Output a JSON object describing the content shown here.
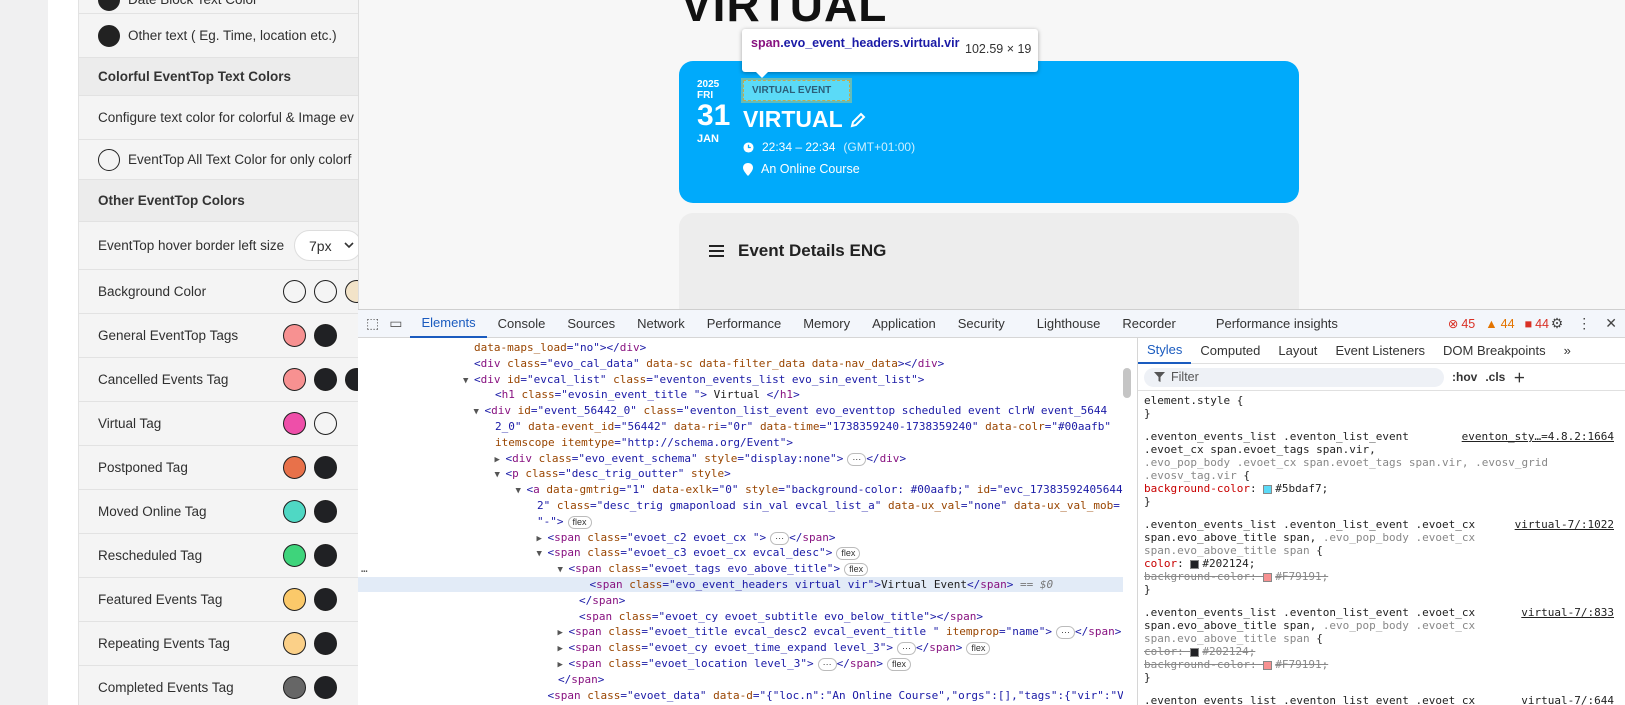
{
  "settings": {
    "rows": [
      {
        "type": "radio",
        "label": "Date Block Text Color",
        "filled": true
      },
      {
        "type": "radio",
        "label": "Other text ( Eg. Time, location etc.)",
        "filled": true
      },
      {
        "type": "head",
        "label": "Colorful EventTop Text Colors"
      },
      {
        "type": "text",
        "label": "Configure text color for colorful & Image ev"
      },
      {
        "type": "radio",
        "label": "EventTop All Text Color for only colorf",
        "filled": false
      },
      {
        "type": "head",
        "label": "Other EventTop Colors"
      },
      {
        "type": "select",
        "label": "EventTop hover border left size",
        "value": "7px"
      },
      {
        "type": "swatch",
        "label": "Background Color",
        "colors": [
          "#f4f4f4",
          "#f4f4f4",
          "#f2e3c8"
        ]
      },
      {
        "type": "swatch",
        "label": "General EventTop Tags",
        "colors": [
          "#f79191",
          "#202124"
        ]
      },
      {
        "type": "swatch",
        "label": "Cancelled Events Tag",
        "colors": [
          "#f79191",
          "#202124",
          "#202124"
        ]
      },
      {
        "type": "swatch",
        "label": "Virtual Tag",
        "colors": [
          "#ee4fa9",
          "#f4f4f4"
        ]
      },
      {
        "type": "swatch",
        "label": "Postponed Tag",
        "colors": [
          "#e8714a",
          "#202124"
        ]
      },
      {
        "type": "swatch",
        "label": "Moved Online Tag",
        "colors": [
          "#4fd8c4",
          "#202124"
        ]
      },
      {
        "type": "swatch",
        "label": "Rescheduled Tag",
        "colors": [
          "#3ed47b",
          "#202124"
        ]
      },
      {
        "type": "swatch",
        "label": "Featured Events Tag",
        "colors": [
          "#fbc96a",
          "#202124"
        ]
      },
      {
        "type": "swatch",
        "label": "Repeating Events Tag",
        "colors": [
          "#fbd088",
          "#202124"
        ]
      },
      {
        "type": "swatch",
        "label": "Completed Events Tag",
        "colors": [
          "#666666",
          "#202124"
        ]
      }
    ]
  },
  "preview": {
    "page_title": "VIRTUAL",
    "tooltip": {
      "tag": "span",
      "selector": ".evo_event_headers.virtual.vir",
      "dims": "102.59 × 19"
    },
    "event": {
      "year": "2025",
      "weekday": "FRI",
      "day": "31",
      "month": "JAN",
      "tag": "VIRTUAL EVENT",
      "title": "VIRTUAL",
      "time": "22:34 – 22:34",
      "timezone": "(GMT+01:00)",
      "location": "An Online Course",
      "card_color": "#00aafb",
      "tag_color": "#5bdaf7"
    },
    "details_heading": "Event Details ENG"
  },
  "devtools": {
    "tabs": [
      "Elements",
      "Console",
      "Sources",
      "Network",
      "Performance",
      "Memory",
      "Application",
      "Security",
      "Lighthouse",
      "Recorder",
      "Performance insights"
    ],
    "active_tab": "Elements",
    "errors": "45",
    "warnings": "44",
    "issues": "44",
    "style_tabs": [
      "Styles",
      "Computed",
      "Layout",
      "Event Listeners",
      "DOM Breakpoints"
    ],
    "filter_placeholder": "Filter",
    "hov": ":hov",
    "cls": ".cls",
    "dom_lines": [
      {
        "indent": 10,
        "tri": "",
        "html": "<span class='attr'>data-maps_load</span>=<span class='val'>\"no\"</span>&gt;&lt;/<span class='tagn'>div</span>&gt;"
      },
      {
        "indent": 10,
        "tri": "",
        "html": "&lt;<span class='tagn'>div</span> <span class='attr'>class</span>=<span class='val'>\"evo_cal_data\"</span> <span class='attr'>data-sc</span> <span class='attr'>data-filter_data</span> <span class='attr'>data-nav_data</span>&gt;&lt;/<span class='tagn'>div</span>&gt;"
      },
      {
        "indent": 10,
        "tri": "▼",
        "html": "&lt;<span class='tagn'>div</span> <span class='attr'>id</span>=<span class='val'>\"evcal_list\"</span> <span class='attr'>class</span>=<span class='val'>\"eventon_events_list evo_sin_event_list\"</span>&gt;"
      },
      {
        "indent": 12,
        "tri": "",
        "html": "&lt;<span class='tagn'>h1</span> <span class='attr'>class</span>=<span class='val'>\"evosin_event_title \"</span>&gt;<span class='txt'> Virtual </span>&lt;/<span class='tagn'>h1</span>&gt;"
      },
      {
        "indent": 11,
        "tri": "▼",
        "html": "&lt;<span class='tagn'>div</span> <span class='attr'>id</span>=<span class='val'>\"event_56442_0\"</span> <span class='attr'>class</span>=<span class='val'>\"eventon_list_event evo_eventtop scheduled  event clrW event_5644</span>"
      },
      {
        "indent": 12,
        "tri": "",
        "html": "<span class='val'>2_0\"</span> <span class='attr'>data-event_id</span>=<span class='val'>\"56442\"</span> <span class='attr'>data-ri</span>=<span class='val'>\"0r\"</span> <span class='attr'>data-time</span>=<span class='val'>\"1738359240-1738359240\"</span> <span class='attr'>data-colr</span>=<span class='val'>\"#00aafb\"</span>"
      },
      {
        "indent": 12,
        "tri": "",
        "html": "<span class='attr'>itemscope</span> <span class='attr'>itemtype</span>=<span class='val'>\"http://schema.org/Event\"</span>&gt;"
      },
      {
        "indent": 13,
        "tri": "▶",
        "html": "&lt;<span class='tagn'>div</span> <span class='attr'>class</span>=<span class='val'>\"evo_event_schema\"</span> <span class='attr'>style</span>=<span class='val'>\"display:none\"</span>&gt;<span class='pill'>···</span>&lt;/<span class='tagn'>div</span>&gt;"
      },
      {
        "indent": 13,
        "tri": "▼",
        "html": "&lt;<span class='tagn'>p</span> <span class='attr'>class</span>=<span class='val'>\"desc_trig_outter\"</span> <span class='attr'>style</span>&gt;"
      },
      {
        "indent": 15,
        "tri": "▼",
        "html": "&lt;<span class='tagn'>a</span> <span class='attr'>data-gmtrig</span>=<span class='val'>\"1\"</span> <span class='attr'>data-exlk</span>=<span class='val'>\"0\"</span> <span class='attr'>style</span>=<span class='val'>\"background-color: #00aafb;\"</span> <span class='attr'>id</span>=<span class='val'>\"evc_17383592405644</span>"
      },
      {
        "indent": 16,
        "tri": "",
        "html": "<span class='val'>2\"</span> <span class='attr'>class</span>=<span class='val'>\"desc_trig gmaponload sin_val evcal_list_a\"</span> <span class='attr'>data-ux_val</span>=<span class='val'>\"none\"</span> <span class='attr'>data-ux_val_mob</span>="
      },
      {
        "indent": 16,
        "tri": "",
        "html": "<span class='val'>\"-\"</span>&gt;<span class='pill'>flex</span>"
      },
      {
        "indent": 17,
        "tri": "▶",
        "html": "&lt;<span class='tagn'>span</span> <span class='attr'>class</span>=<span class='val'>\"evoet_c2 evoet_cx \"</span>&gt;<span class='pill'>···</span>&lt;/<span class='tagn'>span</span>&gt;"
      },
      {
        "indent": 17,
        "tri": "▼",
        "html": "&lt;<span class='tagn'>span</span> <span class='attr'>class</span>=<span class='val'>\"evoet_c3 evoet_cx evcal_desc\"</span>&gt;<span class='pill'>flex</span>"
      },
      {
        "indent": 19,
        "tri": "▼",
        "html": "&lt;<span class='tagn'>span</span> <span class='attr'>class</span>=<span class='val'>\"evoet_tags evo_above_title\"</span>&gt;<span class='pill'>flex</span>"
      },
      {
        "indent": 21,
        "tri": "",
        "hl": true,
        "html": "&lt;<span class='tagn'>span</span> <span class='attr'>class</span>=<span class='val'>\"evo_event_headers virtual vir\"</span>&gt;<span class='txt'>Virtual Event</span>&lt;/<span class='tagn'>span</span>&gt; <span class='eq'>== $0</span>"
      },
      {
        "indent": 20,
        "tri": "",
        "html": "&lt;/<span class='tagn'>span</span>&gt;"
      },
      {
        "indent": 20,
        "tri": "",
        "html": "&lt;<span class='tagn'>span</span> <span class='attr'>class</span>=<span class='val'>\"evoet_cy evoet_subtitle evo_below_title\"</span>&gt;&lt;/<span class='tagn'>span</span>&gt;"
      },
      {
        "indent": 19,
        "tri": "▶",
        "html": "&lt;<span class='tagn'>span</span> <span class='attr'>class</span>=<span class='val'>\"evoet_title evcal_desc2 evcal_event_title \"</span> <span class='attr'>itemprop</span>=<span class='val'>\"name\"</span>&gt;<span class='pill'>···</span>&lt;/<span class='tagn'>span</span>&gt;"
      },
      {
        "indent": 19,
        "tri": "▶",
        "html": "&lt;<span class='tagn'>span</span> <span class='attr'>class</span>=<span class='val'>\"evoet_cy evoet_time_expand level_3\"</span>&gt;<span class='pill'>···</span>&lt;/<span class='tagn'>span</span>&gt;<span class='pill'>flex</span>"
      },
      {
        "indent": 19,
        "tri": "▶",
        "html": "&lt;<span class='tagn'>span</span> <span class='attr'>class</span>=<span class='val'>\"evoet_location level_3\"</span>&gt;<span class='pill'>···</span>&lt;/<span class='tagn'>span</span>&gt;<span class='pill'>flex</span>"
      },
      {
        "indent": 18,
        "tri": "",
        "html": "&lt;/<span class='tagn'>span</span>&gt;"
      },
      {
        "indent": 17,
        "tri": "",
        "html": "&lt;<span class='tagn'>span</span> <span class='attr'>class</span>=<span class='val'>\"evoet_data\"</span> <span class='attr'>data-d</span>=<span class='val'>\"{\"loc.n\":\"An Online Course\",\"orgs\":[],\"tags\":{\"vir\":\"Vir</span>"
      }
    ],
    "style_rules": [
      {
        "lines": [
          "element.style {",
          "}"
        ],
        "src": ""
      },
      {
        "lines": [
          ".eventon_events_list .eventon_list_event",
          ".evoet_cx span.evoet_tags span.vir,",
          "<span style='color:#888'>.evo_pop_body .evoet_cx span.evoet_tags span.vir, .evosv_grid</span>",
          "<span style='color:#888'>.evosv_tag.vir</span> {",
          "  <span class='prop'>background-color</span>: <span class='swatch' style='background:#5bdaf7'></span>#5bdaf7;",
          "}"
        ],
        "src": "eventon_sty…=4.8.2:1664"
      },
      {
        "lines": [
          ".eventon_events_list .eventon_list_event .evoet_cx",
          "span.evo_above_title span, <span style='color:#888'>.evo_pop_body .evoet_cx</span>",
          "<span style='color:#888'>span.evo_above_title span</span> {",
          "  <span class='prop'>color</span>: <span class='swatch' style='background:#202124'></span>#202124;",
          "  <span class='strike'>background-color: <span class='swatch' style='background:#F79191'></span>#F79191;</span>",
          "}"
        ],
        "src": "virtual-7/:1022"
      },
      {
        "lines": [
          ".eventon_events_list .eventon_list_event .evoet_cx",
          "span.evo_above_title span, <span style='color:#888'>.evo_pop_body .evoet_cx</span>",
          "<span style='color:#888'>span.evo_above_title span</span> {",
          "  <span class='strike'>color: <span class='swatch' style='background:#202124'></span>#202124;</span>",
          "  <span class='strike'>background-color: <span class='swatch' style='background:#F79191'></span>#F79191;</span>",
          "}"
        ],
        "src": "virtual-7/:833"
      },
      {
        "lines": [
          ".eventon_events_list .eventon_list_event .evoet_cx"
        ],
        "src": "virtual-7/:644"
      }
    ]
  }
}
